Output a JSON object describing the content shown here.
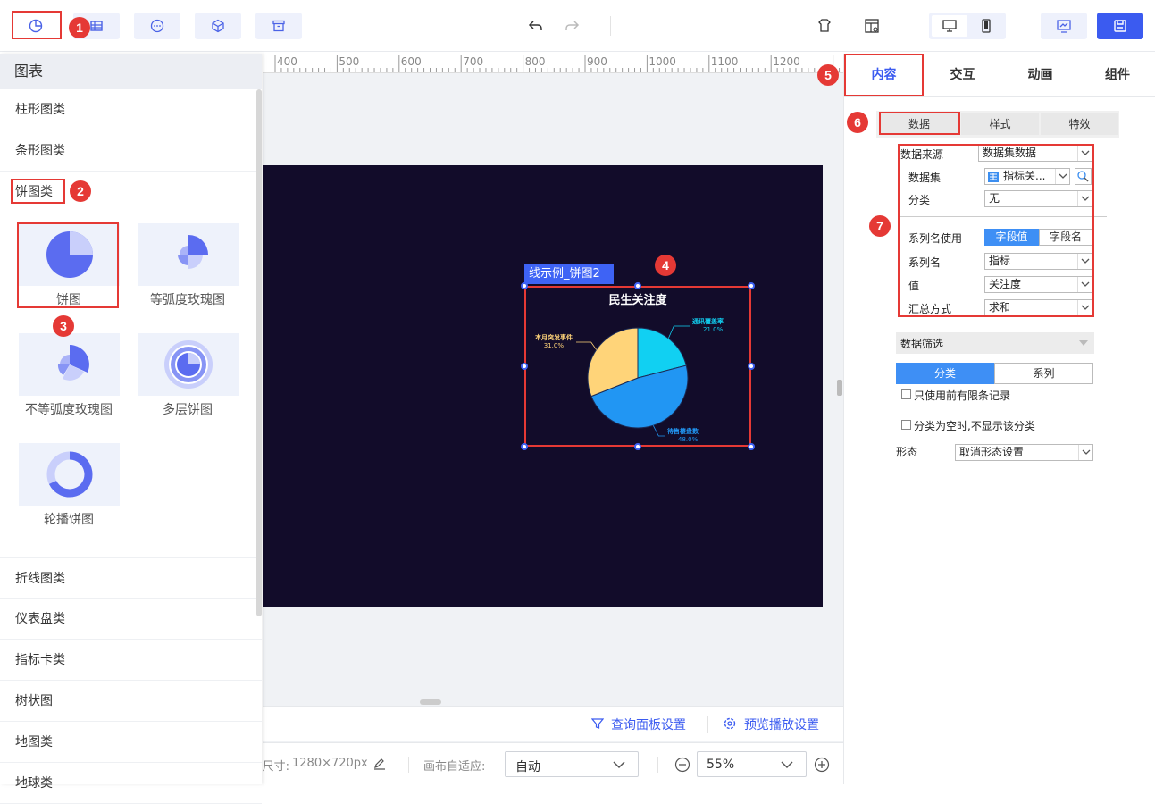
{
  "toolbar": {
    "icons": [
      "pie-chart-icon",
      "table-icon",
      "more-icon",
      "cube-icon",
      "archive-icon"
    ],
    "undo": "undo-icon",
    "redo": "redo-icon",
    "right_icons": [
      "theme-icon",
      "layout-icon",
      "desktop-icon",
      "mobile-icon",
      "preview-icon",
      "save-icon"
    ]
  },
  "badges": [
    "1",
    "2",
    "3",
    "4",
    "5",
    "6",
    "7"
  ],
  "panel": {
    "title": "图表",
    "categories_top": [
      "柱形图类",
      "条形图类",
      "饼图类"
    ],
    "thumbs": [
      "饼图",
      "等弧度玫瑰图",
      "不等弧度玫瑰图",
      "多层饼图",
      "轮播饼图"
    ],
    "categories_bottom": [
      "折线图类",
      "仪表盘类",
      "指标卡类",
      "树状图",
      "地图类",
      "地球类"
    ]
  },
  "ruler": [
    "400",
    "500",
    "600",
    "700",
    "800",
    "900",
    "1000",
    "1100",
    "1200"
  ],
  "widget": {
    "tag": "线示例_饼图2",
    "title": "民生关注度"
  },
  "chart_data": {
    "type": "pie",
    "title": "民生关注度",
    "categories": [
      "通讯覆盖率",
      "待售楼盘数",
      "本月突发事件"
    ],
    "values": [
      21.0,
      48.0,
      31.0
    ],
    "labels": [
      "21.0%",
      "48.0%",
      "31.0%"
    ],
    "colors": [
      "#11d0f2",
      "#2196f3",
      "#ffd479"
    ]
  },
  "bottom": {
    "query": "查询面板设置",
    "preview": "预览播放设置",
    "size_label": "尺寸:",
    "size_value": "1280×720px",
    "fit_label": "画布自适应:",
    "fit_value": "自动",
    "zoom": "55%"
  },
  "right": {
    "tabs": [
      "内容",
      "交互",
      "动画",
      "组件"
    ],
    "subtabs": [
      "数据",
      "样式",
      "特效"
    ],
    "fields": {
      "source_label": "数据来源",
      "source_value": "数据集数据",
      "dataset_label": "数据集",
      "dataset_value": "指标关...",
      "category_label": "分类",
      "category_value": "无",
      "series_use_label": "系列名使用",
      "seg_a": "字段值",
      "seg_b": "字段名",
      "series_label": "系列名",
      "series_value": "指标",
      "value_label": "值",
      "value_value": "关注度",
      "agg_label": "汇总方式",
      "agg_value": "求和"
    },
    "filter": {
      "title": "数据筛选",
      "tab_a": "分类",
      "tab_b": "系列",
      "opt1": "只使用前有限条记录",
      "opt2": "分类为空时,不显示该分类",
      "shape_label": "形态",
      "shape_value": "取消形态设置"
    }
  }
}
